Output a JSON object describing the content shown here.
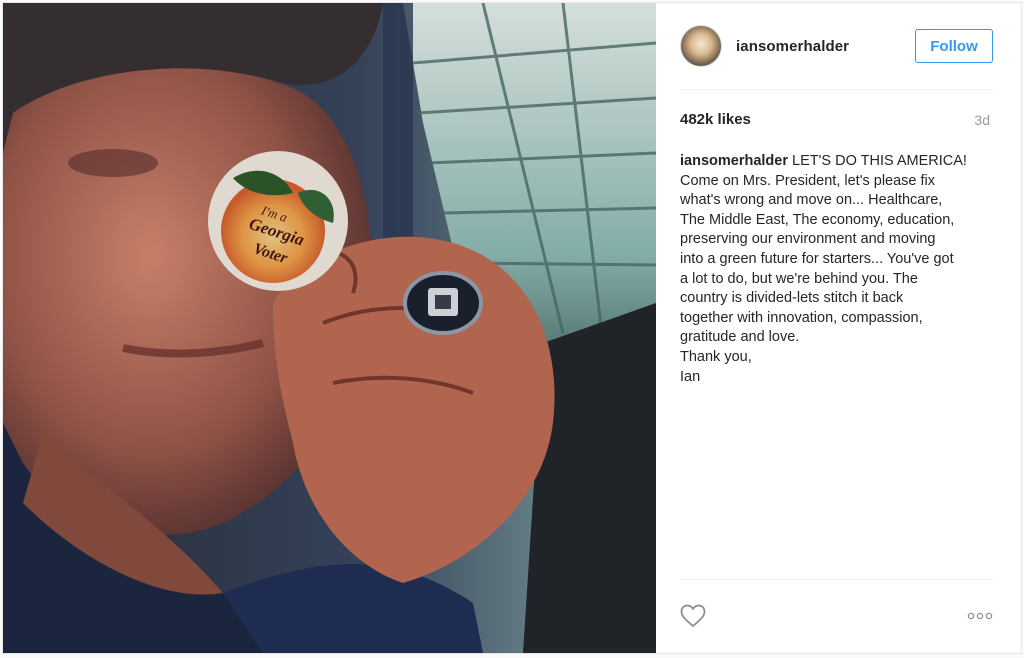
{
  "post": {
    "username": "iansomerhalder",
    "follow_label": "Follow",
    "likes": "482k likes",
    "time": "3d",
    "caption_username": "iansomerhalder",
    "caption_text": "LET'S DO THIS AMERICA!\nCome on Mrs. President, let's please fix\nwhat's wrong and move on... Healthcare,\nThe Middle East, The economy, education,\npreserving our environment and moving\ninto a green future for starters... You've got\na lot to do, but we're behind you. The\ncountry is divided-lets stitch it back\ntogether with innovation, compassion,\ngratitude and love.\nThank you,\nIan",
    "sticker_text": [
      "I'm a",
      "Georgia",
      "Voter"
    ]
  },
  "colors": {
    "accent": "#3897f0",
    "text": "#262626",
    "muted": "#999999",
    "divider": "#efefef"
  },
  "icons": {
    "like": "heart-icon",
    "more": "more-options-icon"
  }
}
